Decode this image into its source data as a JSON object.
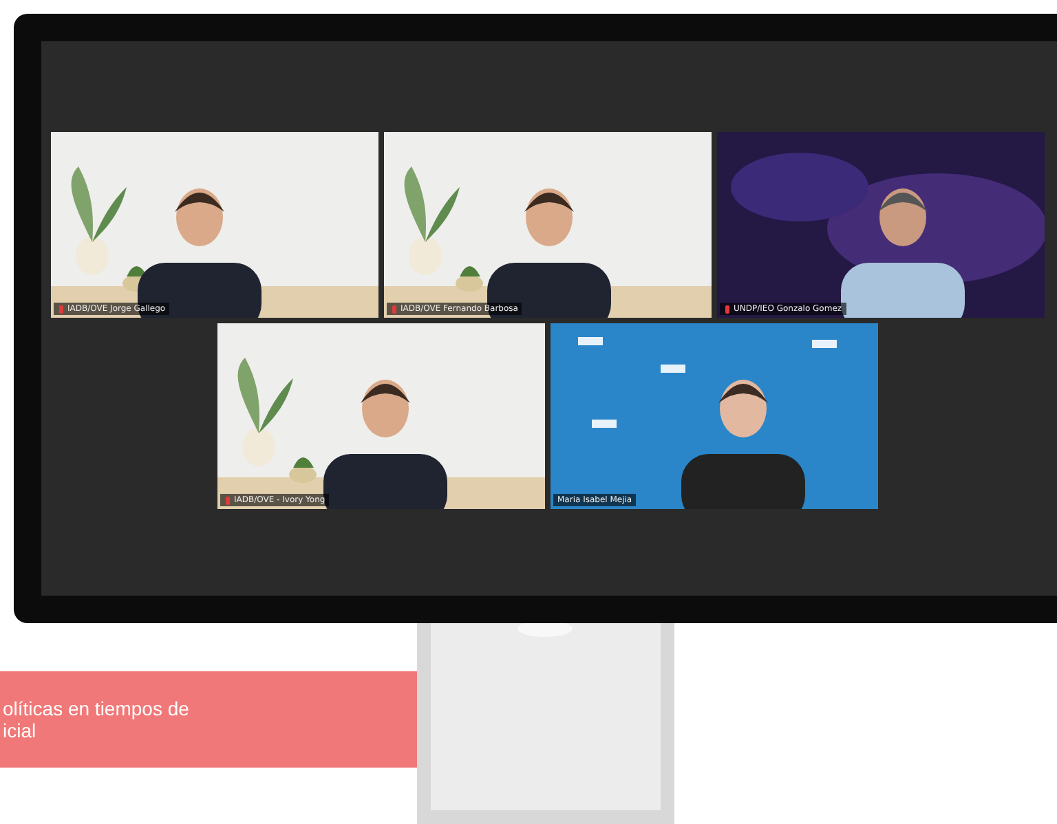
{
  "meeting": {
    "tiles": [
      {
        "kind": "picture",
        "name": "IADB/OVE Jorge Gallego",
        "muted": true
      },
      {
        "kind": "picture",
        "name": "IADB/OVE Fernando Barbosa",
        "muted": true
      },
      {
        "kind": "picture",
        "name": "UNDP/IEO Gonzalo Gomez",
        "muted": true
      },
      {
        "kind": "picture",
        "name": "IADB/OVE - Ivory Yong",
        "muted": true
      },
      {
        "kind": "picture",
        "name": "Maria Isabel Mejia",
        "muted": false
      }
    ]
  },
  "banner": {
    "lines": [
      "olíticas en tiempos de",
      "icial"
    ]
  }
}
